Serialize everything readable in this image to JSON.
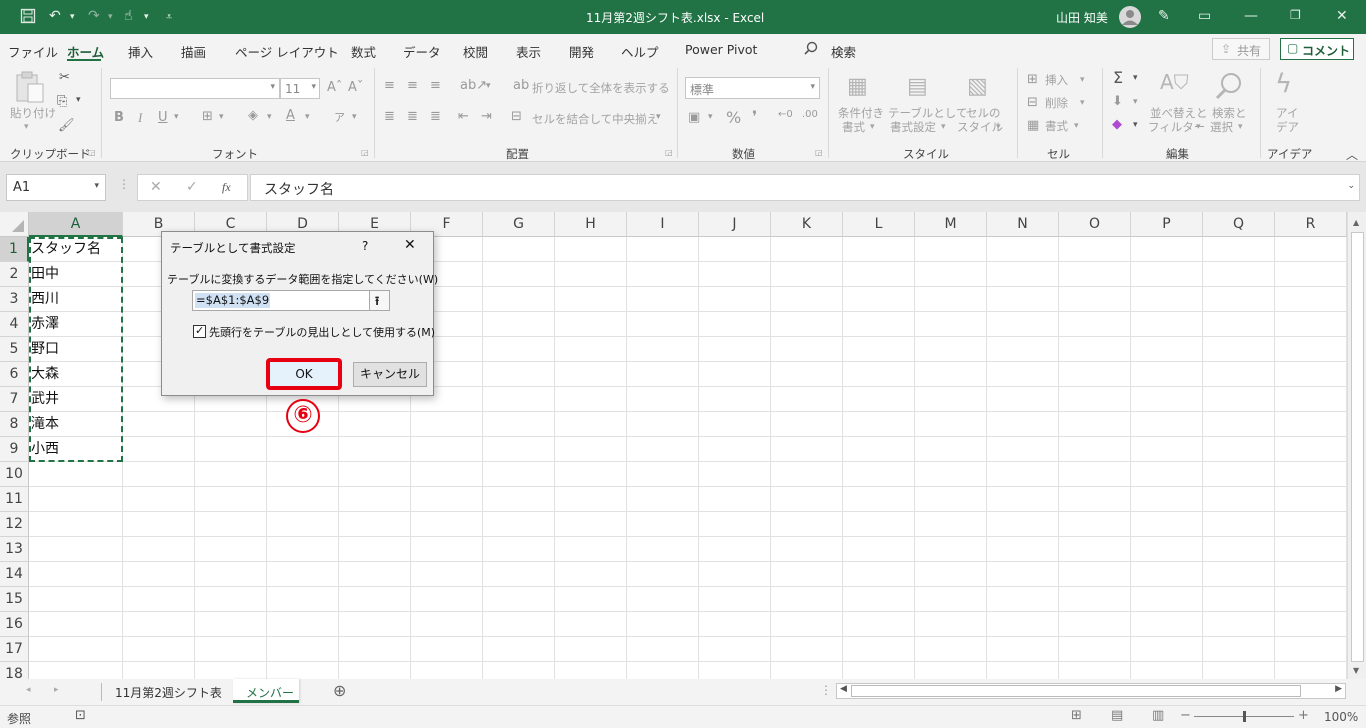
{
  "titlebar": {
    "doc_title": "11月第2週シフト表.xlsx  -  Excel",
    "user_name": "山田 知美"
  },
  "menu_tabs": [
    "ファイル",
    "ホーム",
    "挿入",
    "描画",
    "ページ レイアウト",
    "数式",
    "データ",
    "校閲",
    "表示",
    "開発",
    "ヘルプ",
    "Power Pivot"
  ],
  "search_label": "検索",
  "share_label": "共有",
  "comment_label": "コメント",
  "ribbon": {
    "paste_label": "貼り付け",
    "clipboard_group": "クリップボード",
    "font_size": "11",
    "font_group": "フォント",
    "wrap_text": "折り返して全体を表示する",
    "merge_center": "セルを結合して中央揃え",
    "alignment_group": "配置",
    "number_format": "標準",
    "number_group": "数値",
    "cond_format_1": "条件付き",
    "cond_format_2": "書式",
    "format_table_1": "テーブルとして",
    "format_table_2": "書式設定",
    "cell_style_1": "セルの",
    "cell_style_2": "スタイル",
    "styles_group": "スタイル",
    "insert": "挿入",
    "delete": "削除",
    "format": "書式",
    "cells_group": "セル",
    "sort_1": "並べ替えと",
    "sort_2": "フィルター",
    "find_1": "検索と",
    "find_2": "選択",
    "editing_group": "編集",
    "ideas_1": "アイ",
    "ideas_2": "デア",
    "ideas_group": "アイデア"
  },
  "formula_bar": {
    "name_box": "A1",
    "formula": "スタッフ名"
  },
  "columns": [
    "A",
    "B",
    "C",
    "D",
    "E",
    "F",
    "G",
    "H",
    "I",
    "J",
    "K",
    "L",
    "M",
    "N",
    "O",
    "P",
    "Q",
    "R"
  ],
  "rows": [
    "1",
    "2",
    "3",
    "4",
    "5",
    "6",
    "7",
    "8",
    "9",
    "10",
    "11",
    "12",
    "13",
    "14",
    "15",
    "16",
    "17",
    "18"
  ],
  "cells_a": [
    "スタッフ名",
    "田中",
    "西川",
    "赤澤",
    "野口",
    "大森",
    "武井",
    "滝本",
    "小西"
  ],
  "dialog": {
    "title": "テーブルとして書式設定",
    "help": "?",
    "prompt": "テーブルに変換するデータ範囲を指定してください(W)",
    "range_value": "=$A$1:$A$9",
    "header_checkbox_label": "先頭行をテーブルの見出しとして使用する(M)",
    "header_checked": true,
    "ok_label": "OK",
    "cancel_label": "キャンセル"
  },
  "step_marker": "⑥",
  "sheet_tabs": [
    "11月第2週シフト表",
    "メンバー"
  ],
  "active_sheet": "メンバー",
  "status_text": "参照",
  "zoom_label": "100%",
  "colors": {
    "excel_green": "#217346",
    "highlight_red": "#e60012"
  }
}
